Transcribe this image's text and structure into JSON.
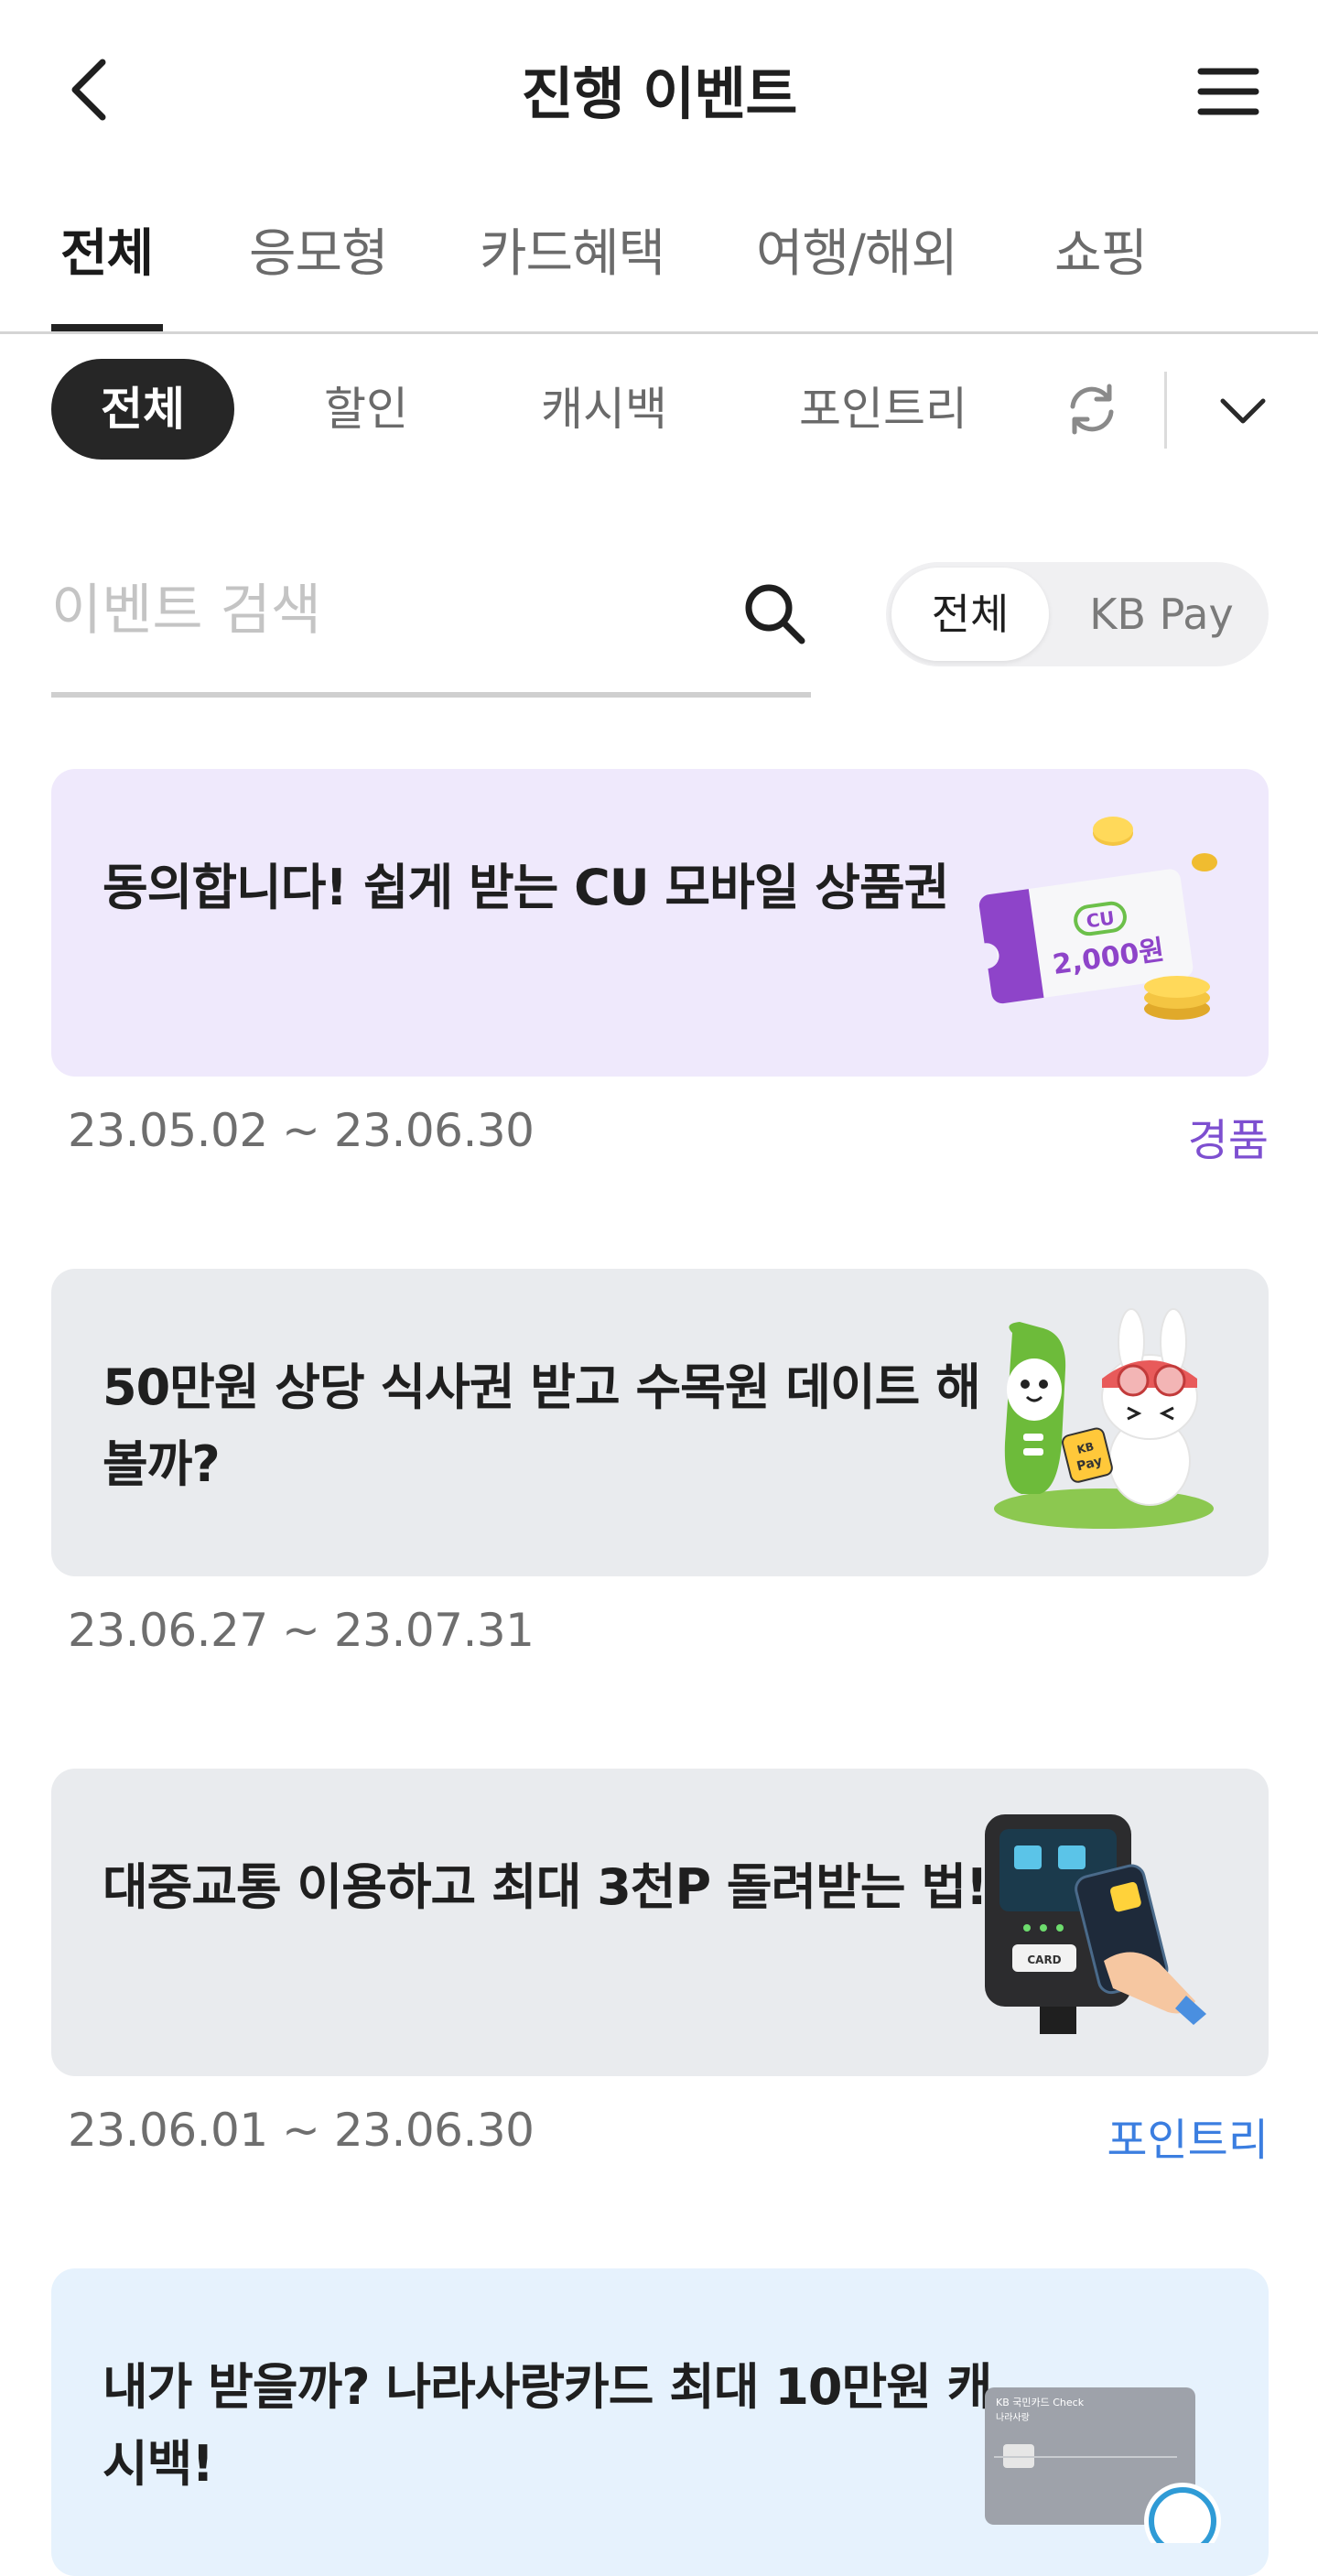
{
  "header": {
    "title": "진행 이벤트"
  },
  "tabs": [
    {
      "label": "전체",
      "active": true
    },
    {
      "label": "응모형",
      "active": false
    },
    {
      "label": "카드혜택",
      "active": false
    },
    {
      "label": "여행/해외",
      "active": false
    },
    {
      "label": "쇼핑",
      "active": false
    }
  ],
  "filters": [
    {
      "label": "전체",
      "active": true
    },
    {
      "label": "할인",
      "active": false
    },
    {
      "label": "캐시백",
      "active": false
    },
    {
      "label": "포인트리",
      "active": false
    }
  ],
  "search": {
    "placeholder": "이벤트 검색",
    "value": ""
  },
  "segment": {
    "options": [
      "전체",
      "KB Pay"
    ],
    "selected": "전체"
  },
  "events": [
    {
      "title": "동의합니다! 쉽게 받는 CU 모바일 상품권",
      "period": "23.05.02 ~ 23.06.30",
      "tag": "경품",
      "tag_color": "#7d4fd0",
      "bg_color": "#efe9fc",
      "image": "cu-gift-voucher-icon",
      "image_text": [
        "CU",
        "2,000원"
      ]
    },
    {
      "title": "50만원 상당 식사권 받고 수목원 데이트 해볼까?",
      "period": "23.06.27 ~ 23.07.31",
      "tag": "",
      "tag_color": "",
      "bg_color": "#e9ebee",
      "image": "mascot-characters-icon",
      "image_text": [
        "KB",
        "Pay"
      ]
    },
    {
      "title": "대중교통 이용하고 최대 3천P 돌려받는 법!",
      "period": "23.06.01 ~ 23.06.30",
      "tag": "포인트리",
      "tag_color": "#3b7ee0",
      "bg_color": "#e9ebee",
      "image": "transit-card-reader-icon",
      "image_text": [
        "CARD"
      ]
    },
    {
      "title": "내가 받을까? 나라사랑카드 최대 10만원 캐시백!",
      "period": "",
      "tag": "",
      "tag_color": "",
      "bg_color": "#e6f2fd",
      "image": "nara-sarang-card-icon",
      "image_text": [
        "KB 국민카드  Check",
        "나라사랑"
      ]
    }
  ],
  "colors": {
    "active_chip_bg": "#262626",
    "divider": "#d4d4d4",
    "text_primary": "#1f1f1f",
    "text_secondary": "#6e6e6e"
  }
}
